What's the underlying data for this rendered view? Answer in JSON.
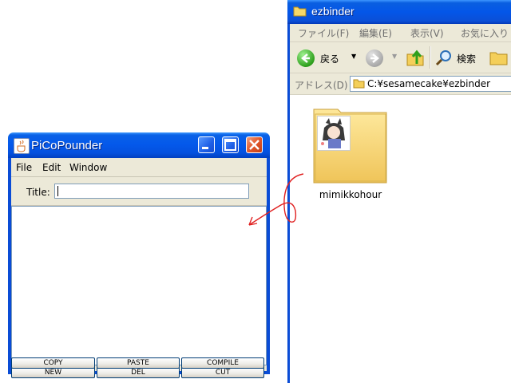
{
  "explorer": {
    "title": "ezbinder",
    "menus": [
      "ファイル(F)",
      "編集(E)",
      "表示(V)",
      "お気に入り"
    ],
    "toolbar": {
      "back_label": "戻る",
      "search_label": "検索"
    },
    "address": {
      "label": "アドレス(D)",
      "value": "C:¥sesamecake¥ezbinder"
    },
    "folder": {
      "name": "mimikkohour"
    }
  },
  "pico": {
    "window_title": "PiCoPounder",
    "menus": [
      "File",
      "Edit",
      "Window"
    ],
    "title_label": "Title:",
    "title_value": "",
    "buttons_row1": [
      "NEW",
      "DEL",
      "CUT"
    ],
    "buttons_row2": [
      "COPY",
      "PASTE",
      "COMPILE"
    ]
  },
  "colors": {
    "xp_blue": "#0a4cd6",
    "xp_face": "#ece9d8",
    "annotation_red": "#e02020"
  }
}
